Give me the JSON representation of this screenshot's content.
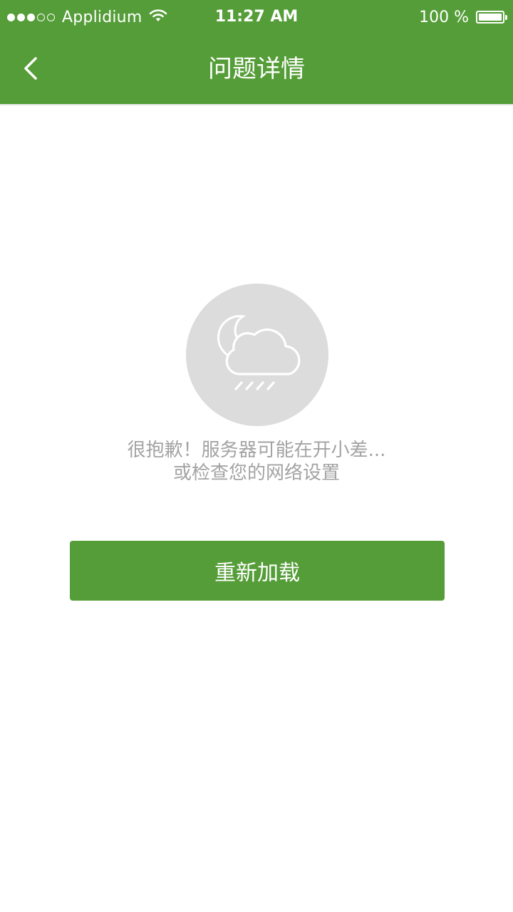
{
  "status_bar": {
    "signal_filled": 3,
    "signal_total": 5,
    "carrier": "Applidium",
    "time": "11:27 AM",
    "battery_text": "100 %",
    "battery_level": 1.0
  },
  "nav": {
    "back_icon": "chevron-left-icon",
    "title": "问题详情"
  },
  "error": {
    "icon": "night-rain-cloud-icon",
    "line1": "很抱歉！服务器可能在开小差...",
    "line2": "或检查您的网络设置"
  },
  "reload_button": {
    "label": "重新加载"
  },
  "colors": {
    "accent": "#559d38",
    "placeholder_circle": "#dcdcdc",
    "message_text": "#a3a3a3"
  }
}
